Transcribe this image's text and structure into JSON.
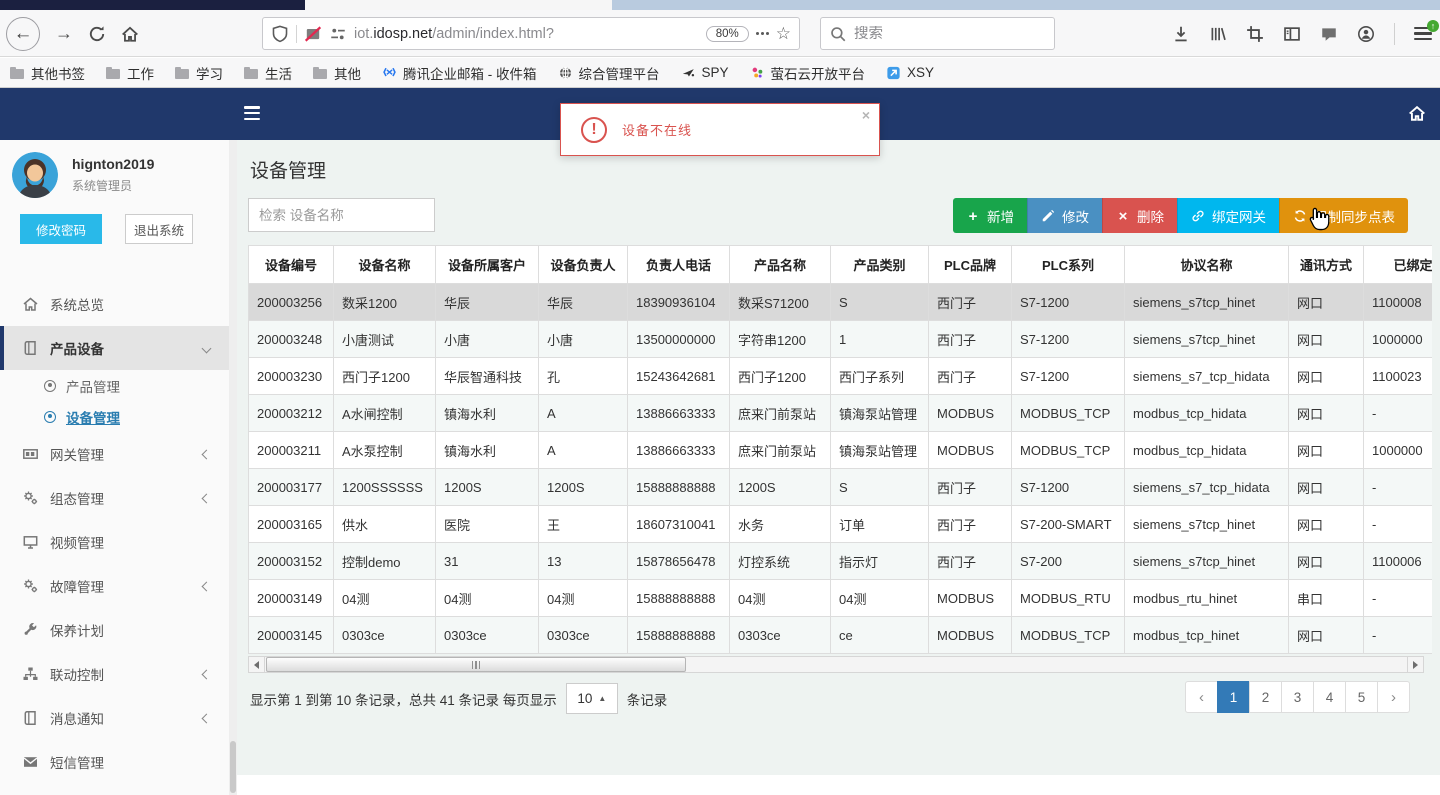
{
  "browser": {
    "toolbar": {
      "url_prefix": "iot.",
      "url_host": "idosp.net",
      "url_path": "/admin/index.html?",
      "zoom_badge": "80%",
      "search_placeholder": "搜索"
    },
    "bookmarks": [
      {
        "label": "其他书签",
        "icon": "folder"
      },
      {
        "label": "工作",
        "icon": "folder"
      },
      {
        "label": "学习",
        "icon": "folder"
      },
      {
        "label": "生活",
        "icon": "folder"
      },
      {
        "label": "其他",
        "icon": "folder"
      },
      {
        "label": "腾讯企业邮箱 - 收件箱",
        "icon": "tencent"
      },
      {
        "label": "综合管理平台",
        "icon": "globe"
      },
      {
        "label": "SPY",
        "icon": "spy"
      },
      {
        "label": "萤石云开放平台",
        "icon": "ys"
      },
      {
        "label": "XSY",
        "icon": "xsy"
      }
    ]
  },
  "app": {
    "alert": {
      "message": "设备不在线",
      "close": "×"
    },
    "sidebar": {
      "username": "hignton2019",
      "role": "系统管理员",
      "change_password": "修改密码",
      "logout": "退出系统",
      "accent_color": "#29b9e9",
      "menu": [
        {
          "label": "系统总览",
          "icon": "home"
        },
        {
          "label": "产品设备",
          "icon": "book",
          "chevron": "down",
          "active": true,
          "submenu": [
            {
              "label": "产品管理",
              "active": false
            },
            {
              "label": "设备管理",
              "active": true
            }
          ]
        },
        {
          "label": "网关管理",
          "icon": "card",
          "chevron": "left"
        },
        {
          "label": "组态管理",
          "icon": "gears",
          "chevron": "left"
        },
        {
          "label": "视频管理",
          "icon": "monitor"
        },
        {
          "label": "故障管理",
          "icon": "gears",
          "chevron": "left"
        },
        {
          "label": "保养计划",
          "icon": "wrench"
        },
        {
          "label": "联动控制",
          "icon": "sitemap",
          "chevron": "left"
        },
        {
          "label": "消息通知",
          "icon": "book",
          "chevron": "left"
        },
        {
          "label": "短信管理",
          "icon": "envelope"
        }
      ]
    },
    "main": {
      "title": "设备管理",
      "search_placeholder": "检索 设备名称",
      "buttons": [
        {
          "label": "新增",
          "icon": "plus",
          "color": "#18a54b"
        },
        {
          "label": "修改",
          "icon": "pencil",
          "color": "#4a90c2"
        },
        {
          "label": "删除",
          "icon": "cross",
          "color": "#d9534f"
        },
        {
          "label": "绑定网关",
          "icon": "link",
          "color": "#00b7ee"
        },
        {
          "label": "强制同步点表",
          "icon": "refresh",
          "color": "#e0920d"
        }
      ],
      "table": {
        "columns": [
          "设备编号",
          "设备名称",
          "设备所属客户",
          "设备负责人",
          "负责人电话",
          "产品名称",
          "产品类别",
          "PLC品牌",
          "PLC系列",
          "协议名称",
          "通讯方式",
          "已绑定网关"
        ],
        "selected_row": 0,
        "rows": [
          [
            "200003256",
            "数采1200",
            "华辰",
            "华辰",
            "18390936104",
            "数采S71200",
            "S",
            "西门子",
            "S7-1200",
            "siemens_s7tcp_hinet",
            "网口",
            "1100008"
          ],
          [
            "200003248",
            "小唐测试",
            "小唐",
            "小唐",
            "13500000000",
            "字符串1200",
            "1",
            "西门子",
            "S7-1200",
            "siemens_s7tcp_hinet",
            "网口",
            "1000000"
          ],
          [
            "200003230",
            "西门子1200",
            "华辰智通科技",
            "孔",
            "15243642681",
            "西门子1200",
            "西门子系列",
            "西门子",
            "S7-1200",
            "siemens_s7_tcp_hidata",
            "网口",
            "1100023"
          ],
          [
            "200003212",
            "A水闸控制",
            "镇海水利",
            "A",
            "13886663333",
            "庶来门前泵站",
            "镇海泵站管理",
            "MODBUS",
            "MODBUS_TCP",
            "modbus_tcp_hidata",
            "网口",
            "-"
          ],
          [
            "200003211",
            "A水泵控制",
            "镇海水利",
            "A",
            "13886663333",
            "庶来门前泵站",
            "镇海泵站管理",
            "MODBUS",
            "MODBUS_TCP",
            "modbus_tcp_hidata",
            "网口",
            "1000000"
          ],
          [
            "200003177",
            "1200SSSSSS",
            "1200S",
            "1200S",
            "15888888888",
            "1200S",
            "S",
            "西门子",
            "S7-1200",
            "siemens_s7_tcp_hidata",
            "网口",
            "-"
          ],
          [
            "200003165",
            "供水",
            "医院",
            "王",
            "18607310041",
            "水务",
            "订单",
            "西门子",
            "S7-200-SMART",
            "siemens_s7tcp_hinet",
            "网口",
            "-"
          ],
          [
            "200003152",
            "控制demo",
            "31",
            "13",
            "15878656478",
            "灯控系统",
            "指示灯",
            "西门子",
            "S7-200",
            "siemens_s7tcp_hinet",
            "网口",
            "1100006"
          ],
          [
            "200003149",
            "04测",
            "04测",
            "04测",
            "15888888888",
            "04测",
            "04测",
            "MODBUS",
            "MODBUS_RTU",
            "modbus_rtu_hinet",
            "串口",
            "-"
          ],
          [
            "200003145",
            "0303ce",
            "0303ce",
            "0303ce",
            "15888888888",
            "0303ce",
            "ce",
            "MODBUS",
            "MODBUS_TCP",
            "modbus_tcp_hinet",
            "网口",
            "-"
          ]
        ]
      },
      "pagination": {
        "info_prefix": "显示第 1 到第 10 条记录，总共 41 条记录 每页显示",
        "page_size": "10",
        "info_suffix": "条记录",
        "pages": [
          "1",
          "2",
          "3",
          "4",
          "5"
        ],
        "active_page": "1"
      }
    }
  }
}
